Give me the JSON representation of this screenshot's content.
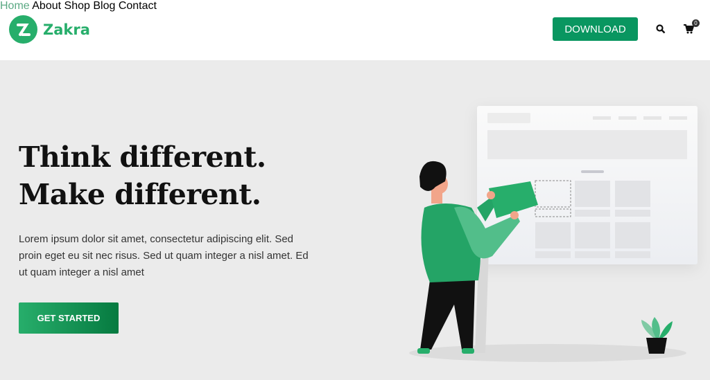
{
  "brand": {
    "name": "Zakra",
    "color": "#27ae6b"
  },
  "nav": {
    "items": [
      {
        "label": "Home",
        "active": true
      },
      {
        "label": "About"
      },
      {
        "label": "Shop"
      },
      {
        "label": "Blog"
      },
      {
        "label": "Contact"
      }
    ],
    "download_label": "DOWNLOAD",
    "cart_count": "0",
    "active_color": "#5aa983"
  },
  "hero": {
    "title_line1": "Think different.",
    "title_line2": "Make different.",
    "description": "Lorem ipsum dolor sit amet, consectetur adipiscing elit. Sed proin eget eu sit nec risus. Sed ut quam integer a nisl amet.  Ed ut quam integer a nisl amet",
    "cta_label": "GET STARTED"
  },
  "icons": {
    "search": "search-icon",
    "cart": "cart-icon"
  }
}
